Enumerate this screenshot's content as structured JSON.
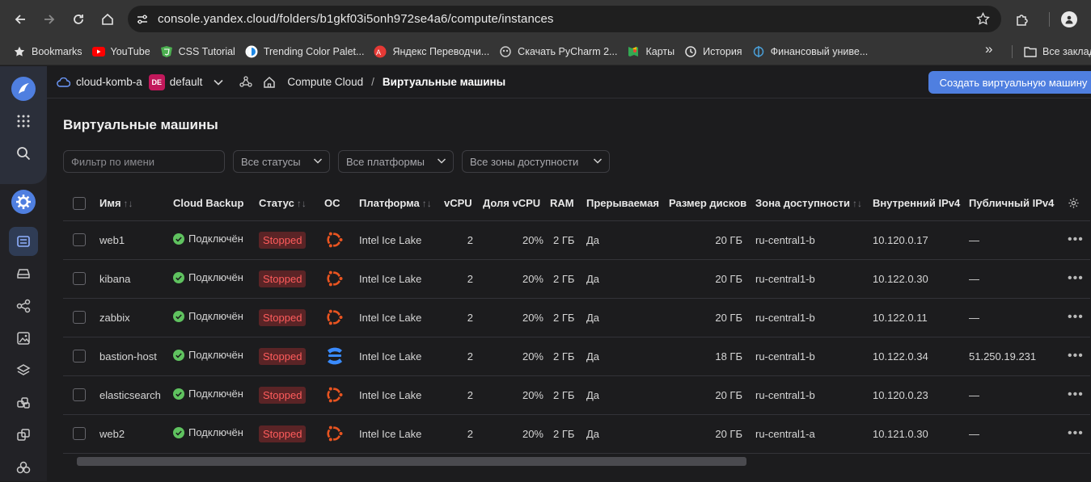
{
  "browser": {
    "url": "console.yandex.cloud/folders/b1gkf03i5onh972se4a6/compute/instances",
    "bookmarks": [
      {
        "label": "Bookmarks",
        "icon": "star-icon"
      },
      {
        "label": "YouTube",
        "icon": "youtube-icon"
      },
      {
        "label": "CSS Tutorial",
        "icon": "css-icon"
      },
      {
        "label": "Trending Color Palet...",
        "icon": "palette-icon"
      },
      {
        "label": "Яндекс Переводчи...",
        "icon": "translate-icon"
      },
      {
        "label": "Скачать PyCharm 2...",
        "icon": "pycharm-icon"
      },
      {
        "label": "Карты",
        "icon": "maps-icon"
      },
      {
        "label": "История",
        "icon": "history-icon"
      },
      {
        "label": "Финансовый униве...",
        "icon": "finance-icon"
      }
    ],
    "more_bookmarks": "»",
    "all_bookmarks": "Все заклад"
  },
  "topbar": {
    "cloud": "cloud-komb-a",
    "folder_badge": "DE",
    "folder": "default",
    "service": "Compute Cloud",
    "separator": "/",
    "current": "Виртуальные машины",
    "create_button": "Создать виртуальную машину"
  },
  "page": {
    "title": "Виртуальные машины",
    "filter_placeholder": "Фильтр по имени",
    "status_select": "Все статусы",
    "platform_select": "Все платформы",
    "zone_select": "Все зоны доступности"
  },
  "table": {
    "columns": {
      "name": "Имя",
      "backup": "Cloud Backup",
      "status": "Статус",
      "os": "ОС",
      "platform": "Платформа",
      "vcpu": "vCPU",
      "share": "Доля vCPU",
      "ram": "RAM",
      "preempt": "Прерываемая",
      "disk": "Размер дисков",
      "zone": "Зона доступности",
      "ipv4": "Внутренний IPv4",
      "public": "Публичный IPv4"
    },
    "sort_mark": "↑↓",
    "rows": [
      {
        "name": "web1",
        "backup": "Подключён",
        "status": "Stopped",
        "os": "ubuntu",
        "platform": "Intel Ice Lake",
        "vcpu": "2",
        "share": "20%",
        "ram": "2 ГБ",
        "preempt": "Да",
        "disk": "20 ГБ",
        "zone": "ru-central1-b",
        "ipv4": "10.120.0.17",
        "public": "—"
      },
      {
        "name": "kibana",
        "backup": "Подключён",
        "status": "Stopped",
        "os": "ubuntu",
        "platform": "Intel Ice Lake",
        "vcpu": "2",
        "share": "20%",
        "ram": "2 ГБ",
        "preempt": "Да",
        "disk": "20 ГБ",
        "zone": "ru-central1-b",
        "ipv4": "10.122.0.30",
        "public": "—"
      },
      {
        "name": "zabbix",
        "backup": "Подключён",
        "status": "Stopped",
        "os": "ubuntu",
        "platform": "Intel Ice Lake",
        "vcpu": "2",
        "share": "20%",
        "ram": "2 ГБ",
        "preempt": "Да",
        "disk": "20 ГБ",
        "zone": "ru-central1-b",
        "ipv4": "10.122.0.11",
        "public": "—"
      },
      {
        "name": "bastion-host",
        "backup": "Подключён",
        "status": "Stopped",
        "os": "nat",
        "platform": "Intel Ice Lake",
        "vcpu": "2",
        "share": "20%",
        "ram": "2 ГБ",
        "preempt": "Да",
        "disk": "18 ГБ",
        "zone": "ru-central1-b",
        "ipv4": "10.122.0.34",
        "public": "51.250.19.231"
      },
      {
        "name": "elasticsearch",
        "backup": "Подключён",
        "status": "Stopped",
        "os": "ubuntu",
        "platform": "Intel Ice Lake",
        "vcpu": "2",
        "share": "20%",
        "ram": "2 ГБ",
        "preempt": "Да",
        "disk": "20 ГБ",
        "zone": "ru-central1-b",
        "ipv4": "10.120.0.23",
        "public": "—"
      },
      {
        "name": "web2",
        "backup": "Подключён",
        "status": "Stopped",
        "os": "ubuntu",
        "platform": "Intel Ice Lake",
        "vcpu": "2",
        "share": "20%",
        "ram": "2 ГБ",
        "preempt": "Да",
        "disk": "20 ГБ",
        "zone": "ru-central1-a",
        "ipv4": "10.121.0.30",
        "public": "—"
      }
    ],
    "row_menu": "•••"
  },
  "colors": {
    "accent": "#4f7fe0",
    "stopped": "#ff5c5c",
    "ok": "#5fc25f",
    "ubuntu": "#e95420",
    "nat": "#3a8bff"
  }
}
